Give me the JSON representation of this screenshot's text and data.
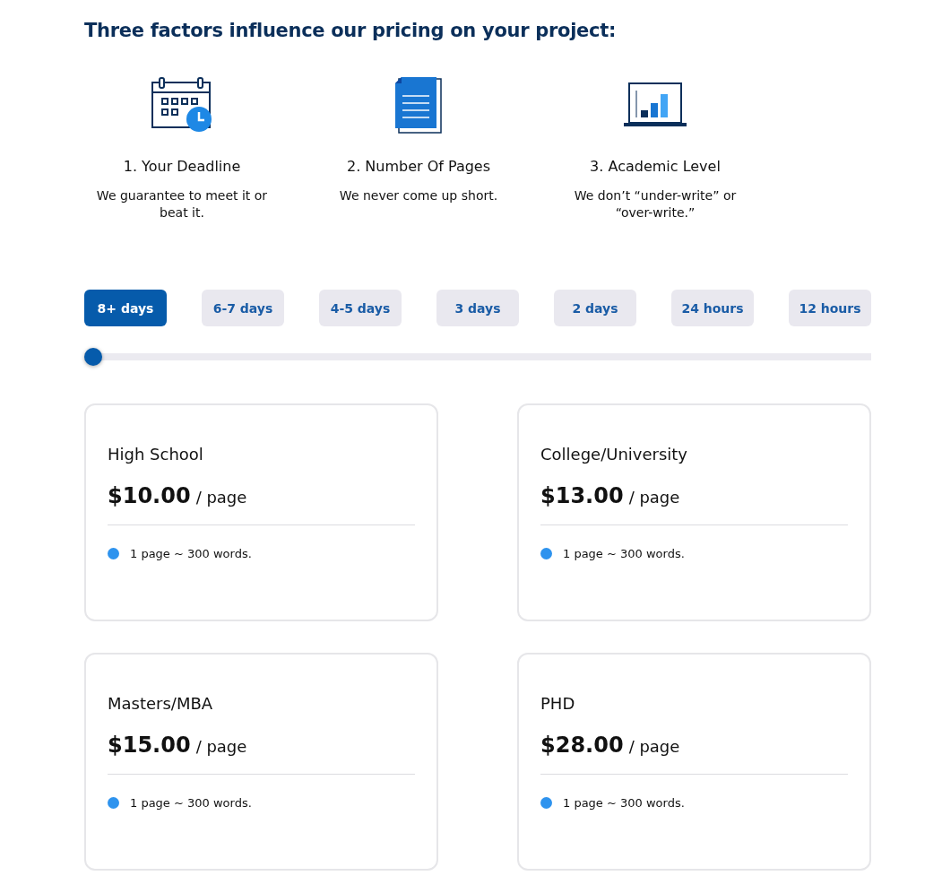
{
  "heading": "Three factors influence our pricing on your project:",
  "factors": [
    {
      "kind": "calendar",
      "title": "1. Your Deadline",
      "text": "We guarantee to meet it or beat it."
    },
    {
      "kind": "document",
      "title": "2. Number Of Pages",
      "text": "We never come up short."
    },
    {
      "kind": "laptop",
      "title": "3. Academic Level",
      "text": "We don’t “under-write” or “over-write.”"
    }
  ],
  "deadline_tabs": [
    {
      "label": "8+ days",
      "selected": true
    },
    {
      "label": "6-7 days",
      "selected": false
    },
    {
      "label": "4-5 days",
      "selected": false
    },
    {
      "label": "3 days",
      "selected": false
    },
    {
      "label": "2 days",
      "selected": false
    },
    {
      "label": "24 hours",
      "selected": false
    },
    {
      "label": "12 hours",
      "selected": false
    }
  ],
  "deadline_slider": {
    "level": 0
  },
  "price_cards": [
    {
      "level": "High School",
      "price": "$10.00",
      "unit": "/ page",
      "note": "1 page ~ 300 words."
    },
    {
      "level": "College/University",
      "price": "$13.00",
      "unit": "/ page",
      "note": "1 page ~ 300 words."
    },
    {
      "level": "Masters/MBA",
      "price": "$15.00",
      "unit": "/ page",
      "note": "1 page ~ 300 words."
    },
    {
      "level": "PHD",
      "price": "$28.00",
      "unit": "/ page",
      "note": "1 page ~ 300 words."
    }
  ]
}
